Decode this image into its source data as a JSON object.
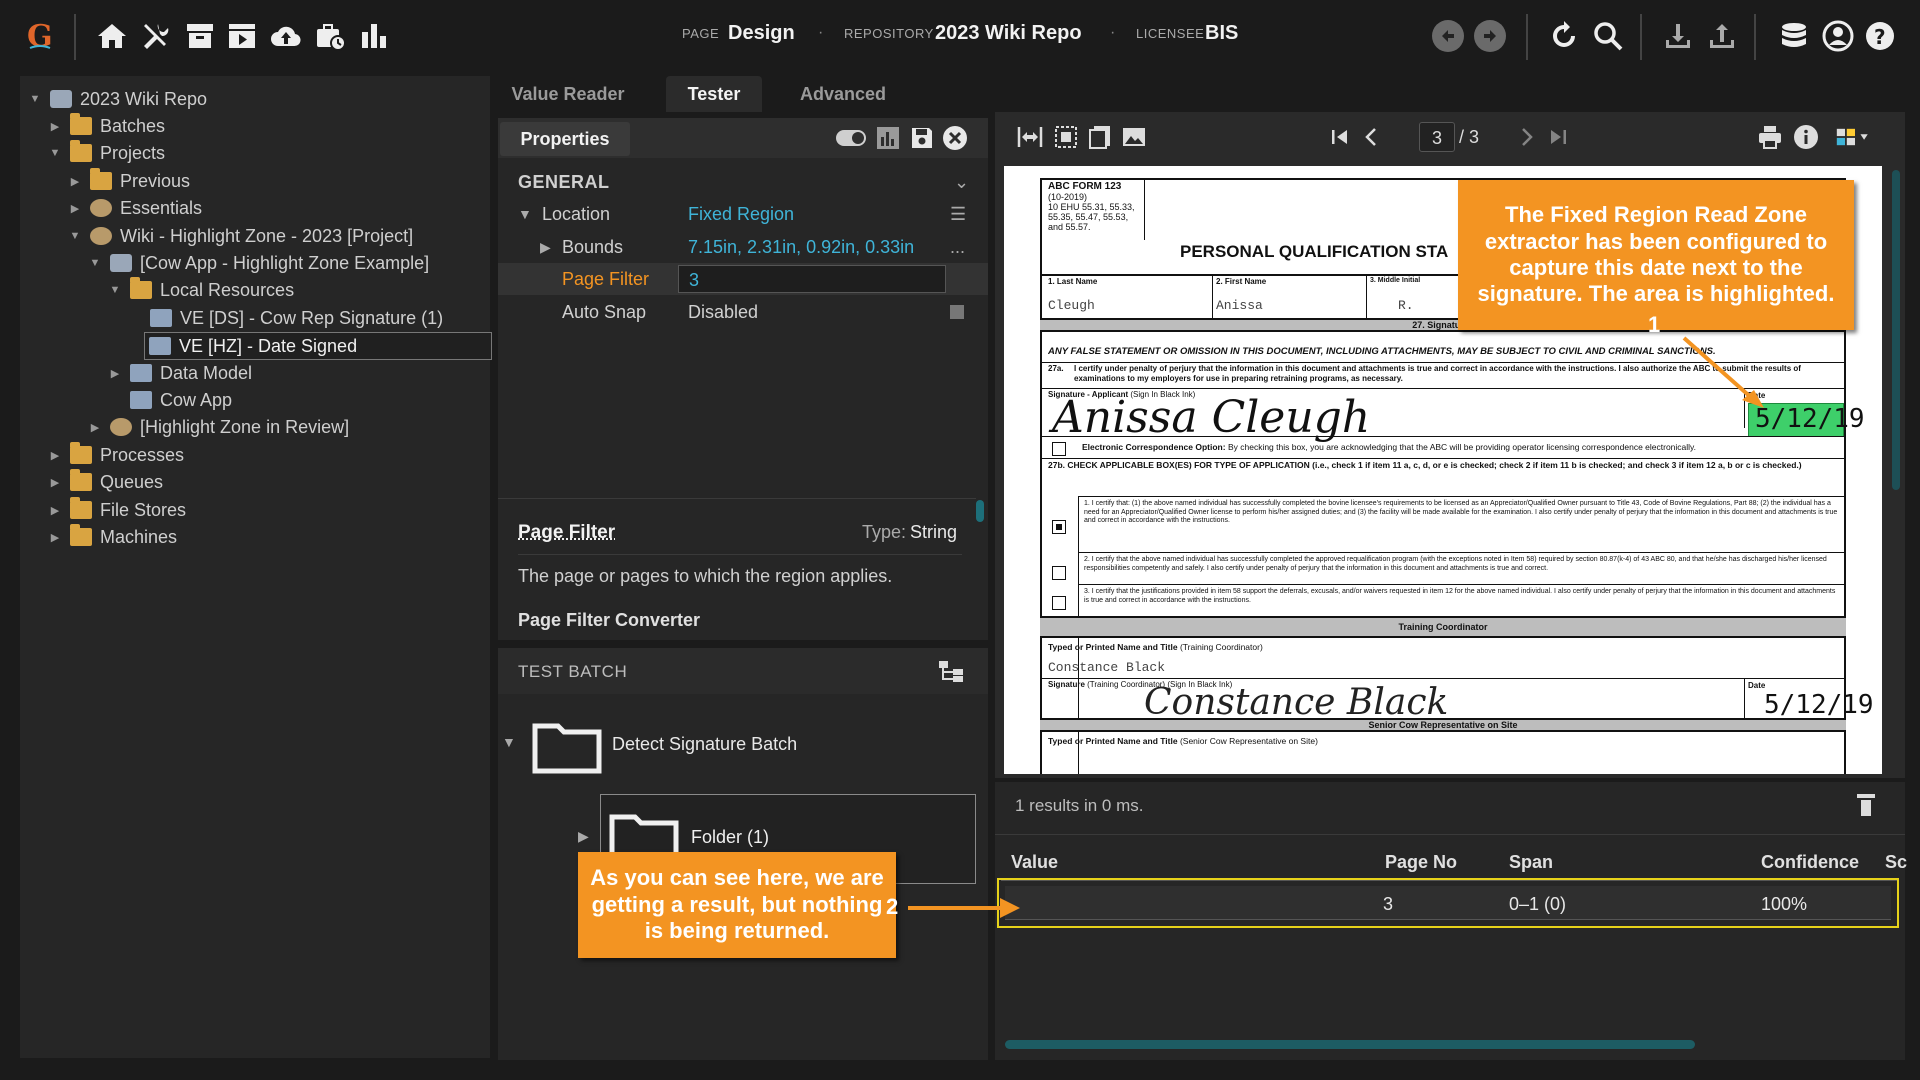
{
  "header": {
    "page_label": "PAGE",
    "page_value": "Design",
    "repo_label": "REPOSITORY",
    "repo_value": "2023 Wiki Repo",
    "licensee_label": "LICENSEE",
    "licensee_value": "BIS"
  },
  "tree": {
    "items": [
      {
        "label": "2023 Wiki Repo"
      },
      {
        "label": "Batches"
      },
      {
        "label": "Projects"
      },
      {
        "label": "Previous"
      },
      {
        "label": "Essentials"
      },
      {
        "label": "Wiki - Highlight Zone - 2023 [Project]"
      },
      {
        "label": "[Cow App - Highlight Zone Example]"
      },
      {
        "label": "Local Resources"
      },
      {
        "label": "VE [DS] - Cow Rep Signature (1)"
      },
      {
        "label": "VE [HZ] - Date Signed"
      },
      {
        "label": "Data Model"
      },
      {
        "label": "Cow App"
      },
      {
        "label": "[Highlight Zone in Review]"
      },
      {
        "label": "Processes"
      },
      {
        "label": "Queues"
      },
      {
        "label": "File Stores"
      },
      {
        "label": "Machines"
      }
    ]
  },
  "tabs": {
    "value_reader": "Value Reader",
    "tester": "Tester",
    "advanced": "Advanced"
  },
  "properties": {
    "title": "Properties",
    "section": "GENERAL",
    "location_label": "Location",
    "location_value": "Fixed Region",
    "bounds_label": "Bounds",
    "bounds_value": "7.15in, 2.31in, 0.92in, 0.33in",
    "bounds_more": "...",
    "page_filter_label": "Page Filter",
    "page_filter_value": "3",
    "auto_snap_label": "Auto Snap",
    "auto_snap_value": "Disabled",
    "help_title": "Page Filter",
    "help_type_label": "Type:",
    "help_type_value": "String",
    "help_desc": "The page or pages to which the region applies.",
    "help_converter": "Page Filter Converter"
  },
  "test_batch": {
    "title": "TEST BATCH",
    "batch_name": "Detect Signature Batch",
    "folder_name": "Folder (1)"
  },
  "viewer": {
    "page_current": "3",
    "page_total": "/ 3"
  },
  "document": {
    "form_id": "ABC FORM 123",
    "form_sub1": "(10-2019)",
    "form_sub2": "10 EHU 55.31, 55.33,",
    "form_sub3": "55.35, 55.47, 55.53,",
    "form_sub4": "and 55.57.",
    "title": "PERSONAL QUALIFICATION STA",
    "last_name_label": "1. Last Name",
    "last_name": "Cleugh",
    "first_name_label": "2. First Name",
    "first_name": "Anissa",
    "middle_label": "3. Middle Initial",
    "middle": "R.",
    "signatures_label": "27. Signatures",
    "false_statement": "ANY FALSE STATEMENT OR OMISSION IN THIS DOCUMENT, INCLUDING ATTACHMENTS, MAY BE SUBJECT TO CIVIL AND CRIMINAL SANCTIONS.",
    "certify_27a_num": "27a.",
    "certify_27a": "I certify under penalty of perjury that the information in this document and attachments is true and correct in accordance with the instructions. I also authorize the ABC to submit the results of examinations to my employers for use in preparing retraining programs, as necessary.",
    "sig_applicant_label": "Signature - Applicant",
    "sig_applicant_note": "(Sign In Black Ink)",
    "sig_applicant": "Anissa Cleugh",
    "date_label": "Date",
    "date_value": "5/12/19",
    "electronic_label": "Electronic Correspondence Option:",
    "electronic_text": "By checking this box, you are acknowledging that the ABC will be providing operator licensing correspondence electronically.",
    "check_27b": "27b. CHECK APPLICABLE BOX(ES) FOR TYPE OF APPLICATION (i.e., check 1 if item 11 a, c, d, or e is checked; check 2 if item 11 b is checked; and check 3 if item 12 a, b or c is checked.)",
    "opt1": "1. I certify that: (1) the above named individual has successfully completed the bovine licensee's requirements to be licensed as an Appreciator/Qualified Owner pursuant to Title 43, Code of Bovine Regulations, Part 88; (2) the individual has a need for an Appreciator/Qualified Owner license to perform his/her assigned duties; and (3) the facility will be made available for the examination. I also certify under penalty of perjury that the information in this document and attachments is true and correct in accordance with the instructions.",
    "opt2": "2. I certify that the above named individual has successfully completed the approved requalification program (with the exceptions noted in Item 58) required by section 80.87(k-4) of 43 ABC 80, and that he/she has discharged his/her licensed responsibilities competently and safely. I also certify under penalty of perjury that the information in this document and attachments is true and correct.",
    "opt3": "3. I certify that the justifications provided in item 58 support the deferrals, excusals, and/or waivers requested in item 12 for the above named individual. I also certify under penalty of perjury that the information in this document and attachments is true and correct in accordance with the instructions.",
    "training_coord": "Training Coordinator",
    "typed_name_label": "Typed or Printed Name and Title",
    "typed_name_note": "(Training Coordinator)",
    "typed_name": "Constance Black",
    "sig_training_label": "Signature",
    "sig_training_note": "(Training Coordinator) (Sign In Black Ink)",
    "sig_training": "Constance Black",
    "date2_label": "Date",
    "date2_value": "5/12/19",
    "senior_rep": "Senior Cow Representative on Site",
    "typed_name2_label": "Typed or Printed Name and Title",
    "typed_name2_note": "(Senior Cow Representative on Site)"
  },
  "results": {
    "summary": "1 results in 0 ms.",
    "columns": [
      "Value",
      "Page No",
      "Span",
      "Confidence",
      "Sc"
    ],
    "row": {
      "value": "",
      "page_no": "3",
      "span": "0–1 (0)",
      "confidence": "100%"
    }
  },
  "callouts": {
    "one_text": "The Fixed Region Read Zone extractor has been configured to capture this date next to the signature. The area is highlighted.",
    "one_num": "1",
    "two_text": "As you can see here, we are getting a result, but nothing is being returned.",
    "two_num": "2"
  },
  "colors": {
    "accent_blue": "#3fb4d8",
    "callout_orange": "#f39422",
    "highlight_green": "#3ecf6a",
    "result_outline": "#e6d21a"
  }
}
